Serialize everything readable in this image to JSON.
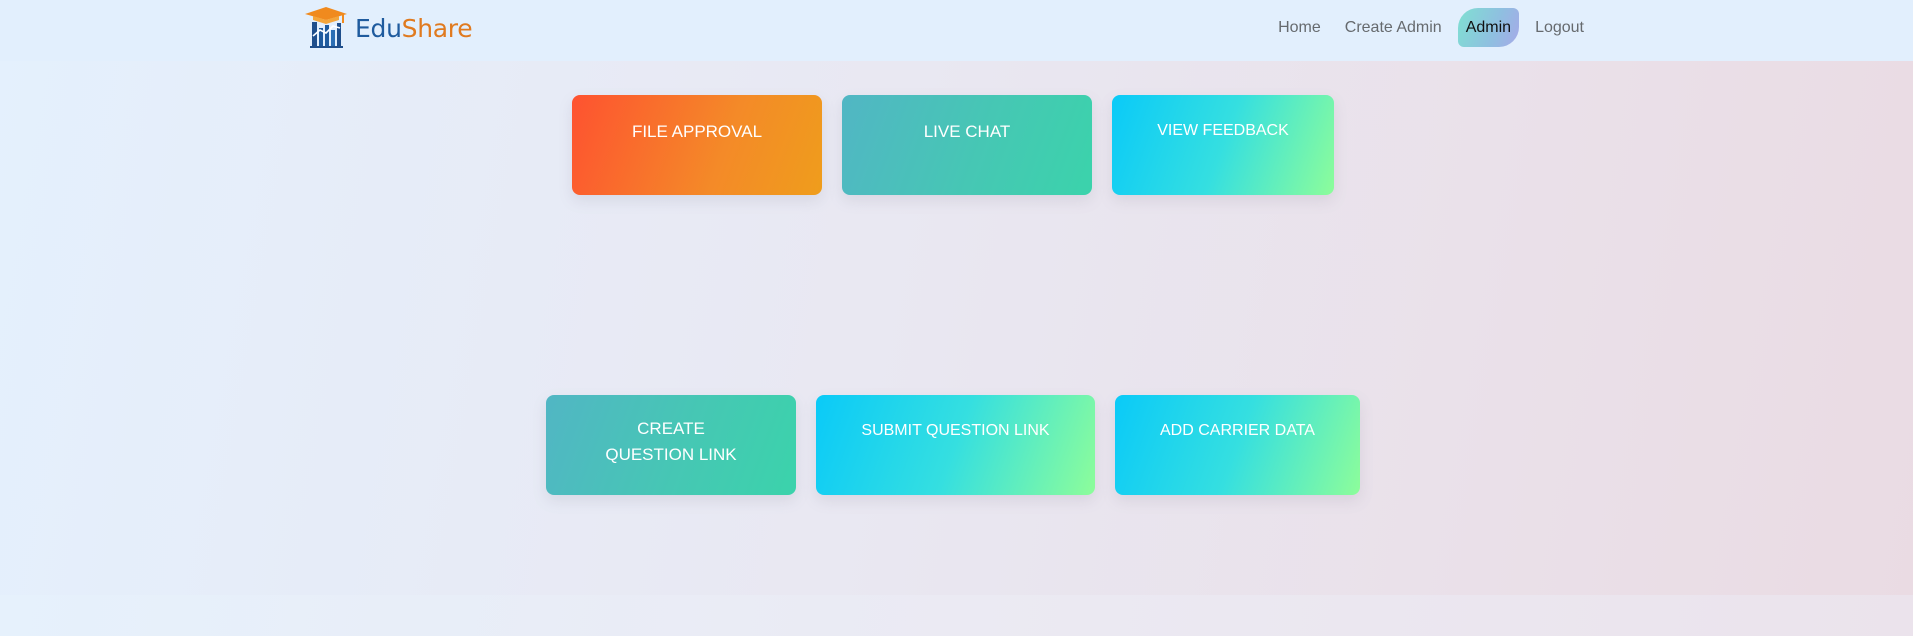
{
  "brand": {
    "name_part1": "Edu",
    "name_part2": "Share",
    "logo_icon": "graduation-cap-building-icon",
    "colors": {
      "primary": "#1f5b9e",
      "accent": "#e07a1f"
    }
  },
  "nav": {
    "items": [
      {
        "label": "Home",
        "active": false
      },
      {
        "label": "Create Admin",
        "active": false
      },
      {
        "label": "Admin",
        "active": true
      },
      {
        "label": "Logout",
        "active": false
      }
    ]
  },
  "cards": {
    "row1": [
      {
        "label": "FILE APPROVAL",
        "gradient": [
          "#fe5230",
          "#ef9d1c"
        ]
      },
      {
        "label": "LIVE CHAT",
        "gradient": [
          "#51b6c4",
          "#3bd3ab"
        ]
      },
      {
        "label": "VIEW FEEDBACK",
        "gradient": [
          "#0acaf8",
          "#8dfd9a"
        ]
      }
    ],
    "row2": [
      {
        "label": "CREATE QUESTION LINK",
        "gradient": [
          "#51b6c4",
          "#3bd3ab"
        ]
      },
      {
        "label": "SUBMIT QUESTION LINK",
        "gradient": [
          "#0acaf8",
          "#8dfd9a"
        ]
      },
      {
        "label": "ADD CARRIER DATA",
        "gradient": [
          "#0acaf8",
          "#8dfd9a"
        ]
      }
    ]
  }
}
